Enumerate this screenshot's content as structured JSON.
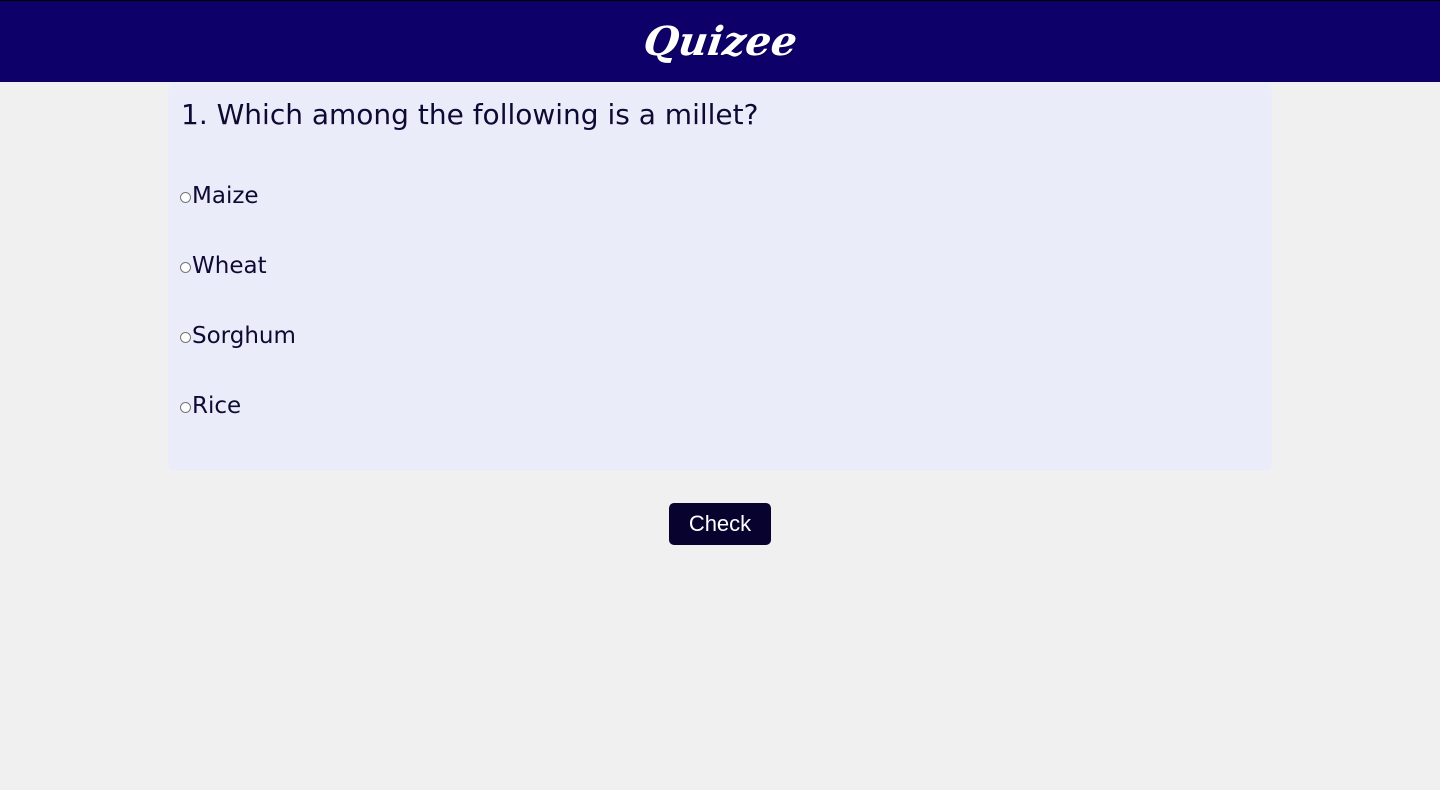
{
  "header": {
    "logo_text": "Quizee",
    "background_color": "#0d0068"
  },
  "quiz": {
    "question": "1. Which among the following is a millet?",
    "options": [
      {
        "label": "Maize",
        "selected": false
      },
      {
        "label": "Wheat",
        "selected": false
      },
      {
        "label": "Sorghum",
        "selected": false
      },
      {
        "label": "Rice",
        "selected": false
      }
    ],
    "card_color": "#eaedf9"
  },
  "actions": {
    "check_label": "Check",
    "button_color": "#07022e"
  }
}
